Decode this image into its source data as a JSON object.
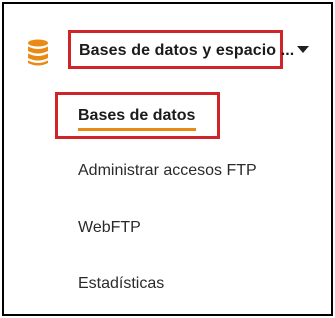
{
  "section": {
    "title": "Bases de datos y espacio ...",
    "icon": "database-icon",
    "icon_color": "#e98a15",
    "expand_icon": "caret-down-icon"
  },
  "submenu": {
    "active": "Bases de datos",
    "items": [
      "Administrar accesos FTP",
      "WebFTP",
      "Estadísticas"
    ]
  },
  "colors": {
    "highlight_border": "#d0242b",
    "active_underline": "#e98a15"
  }
}
